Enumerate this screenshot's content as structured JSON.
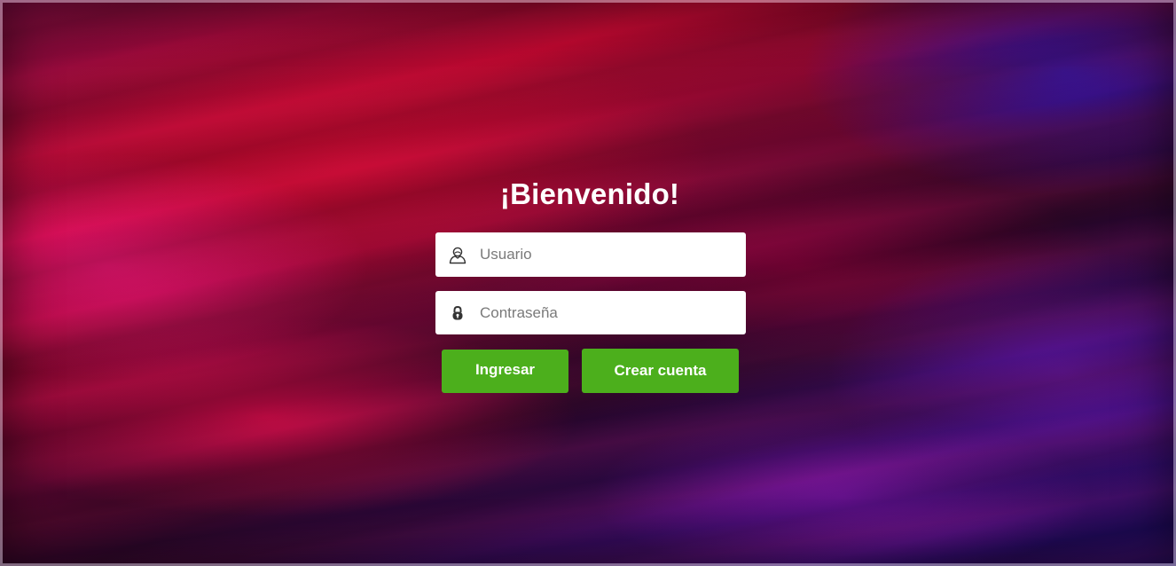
{
  "login": {
    "title": "¡Bienvenido!",
    "username": {
      "placeholder": "Usuario",
      "value": "",
      "icon": "user-icon"
    },
    "password": {
      "placeholder": "Contraseña",
      "value": "",
      "icon": "lock-icon"
    },
    "buttons": {
      "login_label": "Ingresar",
      "create_label": "Crear cuenta"
    }
  },
  "colors": {
    "button_green": "#4caf1c",
    "title_text": "#ffffff",
    "field_background": "#ffffff"
  }
}
